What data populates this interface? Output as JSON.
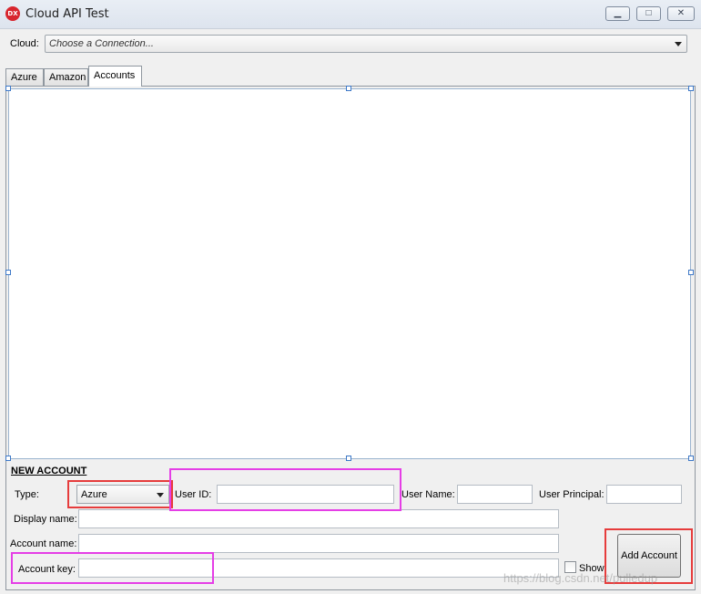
{
  "window": {
    "icon_text": "DX",
    "title": "Cloud API Test",
    "minimize_symbol": "▁",
    "maximize_symbol": "□",
    "close_symbol": "✕"
  },
  "cloud": {
    "label": "Cloud:",
    "value": "Choose a Connection..."
  },
  "tabs": [
    {
      "label": "Azure"
    },
    {
      "label": "Amazon"
    },
    {
      "label": "Accounts",
      "active": true
    }
  ],
  "new_account": {
    "section_title": "NEW ACCOUNT",
    "type_label": "Type:",
    "type_value": "Azure",
    "user_id_label": "User ID:",
    "user_name_label": "User Name:",
    "user_principal_label": "User Principal:",
    "display_name_label": "Display name:",
    "account_name_label": "Account name:",
    "account_key_label": "Account key:",
    "show_label": "Show",
    "add_button": "Add Account"
  },
  "watermark": "https://blog.csdn.net/pulledup",
  "colors": {
    "highlight_red": "#e63c3c",
    "highlight_magenta": "#e53ee6",
    "selection_handle": "#3d78c7"
  }
}
